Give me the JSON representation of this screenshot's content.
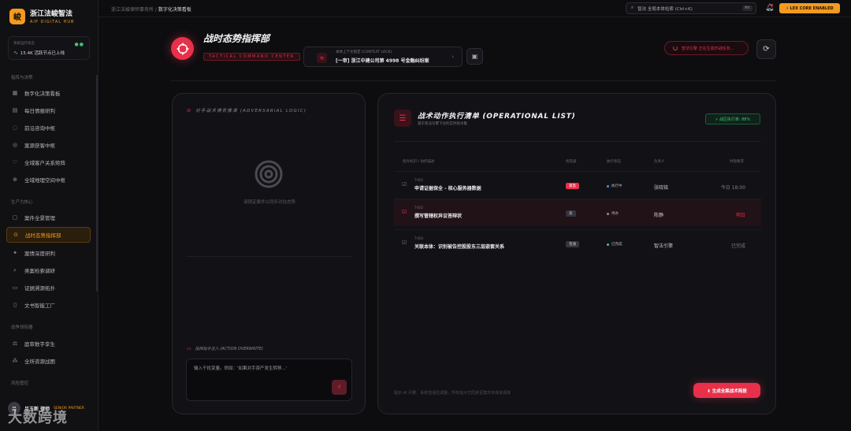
{
  "brand": {
    "logo_char": "峻",
    "title": "浙江法峻智法",
    "subtitle": "AIP DIGITAL HUB"
  },
  "status": {
    "label": "系统运行状态",
    "value": "15.4K 活跃节点已上线"
  },
  "nav": {
    "section1": "指挥与决策",
    "items1": [
      {
        "label": "数字化决策看板",
        "icon": "grid-icon"
      },
      {
        "label": "每日情报研判",
        "icon": "news-icon"
      },
      {
        "label": "前沿咨询中枢",
        "icon": "chat-icon"
      },
      {
        "label": "案源获客中枢",
        "icon": "target-icon"
      },
      {
        "label": "全域客户关系矩阵",
        "icon": "heart-icon"
      },
      {
        "label": "全域地理空间中枢",
        "icon": "globe-icon"
      }
    ],
    "section2": "生产力核心",
    "items2": [
      {
        "label": "案件全景管理",
        "icon": "clipboard-icon"
      },
      {
        "label": "战时态势指挥部",
        "icon": "crosshair-icon",
        "active": true
      },
      {
        "label": "案情深度研判",
        "icon": "spark-icon"
      },
      {
        "label": "类案检索调研",
        "icon": "search-icon"
      },
      {
        "label": "证据溯源拓扑",
        "icon": "doc-icon"
      },
      {
        "label": "文书智能工厂",
        "icon": "file-icon"
      }
    ],
    "section3": "战争领衔器",
    "items3": [
      {
        "label": "庭审数字孪生",
        "icon": "scale-icon"
      },
      {
        "label": "全所资源战图",
        "icon": "nodes-icon"
      }
    ],
    "section4": "风险管控"
  },
  "user": {
    "avatar": "吕",
    "name": "吕玉新 律师",
    "role": "SENIOR PARTNER"
  },
  "watermark": "大数跨境",
  "topbar": {
    "breadcrumb_root": "浙江法峻律师事务所 /",
    "breadcrumb_current": "数字化决策看板",
    "search_placeholder": "智法 全局本体检索 (Ctrl+K)",
    "search_kbd": "⌘K",
    "core_badge": "⚡ LEX CORE ENABLED"
  },
  "header": {
    "title": "战时态势指挥部",
    "subtitle": "TACTICAL COMMAND CENTER",
    "context_label": "本体上下文锁定 (CONTEXT LOCK)",
    "context_value": "[一审] 浙江中建公司第 4998 号金融纠纷案",
    "warning": "智法引擎 正在生成作战任务..."
  },
  "left_panel": {
    "heading": "对手战术博弈推演 (ADVERSARIAL LOGIC)",
    "empty_text": "请锁定案件以同步对抗态势",
    "override_heading": "指挥指令注入 (ACTION OVERWRITE)",
    "override_placeholder": "输入干扰变量。例如：'如果对手资产发生转移...'"
  },
  "right_panel": {
    "title": "战术动作执行清单 (OPERATIONAL LIST)",
    "subtitle": "基于智法引擎下达的实时指令集",
    "rate": "⚡ 战区执行率: 88%",
    "columns": [
      "指令标识 / 动作描述",
      "优先级",
      "执行状态",
      "负责人",
      "时限要求"
    ],
    "rows": [
      {
        "id": "T-001",
        "name": "申请证据保全 - 核心服务器数据",
        "priority": "紧急",
        "priority_color": "#e8304a",
        "priority_text": "#ffffff",
        "status": "执行中",
        "status_color": "#4a8cf0",
        "owner": "张晓铭",
        "due": "今日 18:00",
        "due_color": "#7a7a84"
      },
      {
        "id": "T-002",
        "name": "撰写管辖权异议答辩状",
        "priority": "高",
        "priority_color": "#34343c",
        "priority_text": "#c8c8ce",
        "status": "待办",
        "status_color": "#8b8b95",
        "owner": "陈静",
        "due": "明日",
        "due_color": "#e8304a",
        "highlight": true
      },
      {
        "id": "T-003",
        "name": "关联本体：识别被告控股股东三层嵌套关系",
        "priority": "普通",
        "priority_color": "#34343c",
        "priority_text": "#c8c8ce",
        "status": "已完成",
        "status_color": "#3ec47a",
        "owner": "智法引擎",
        "due": "已完成",
        "due_color": "#7a7a84"
      }
    ],
    "footer": "提示 AI 引擎：系统自适应调整，所有指令已同步至案件本体资源库",
    "generate_button": "⬇ 生成全案战术简报"
  }
}
